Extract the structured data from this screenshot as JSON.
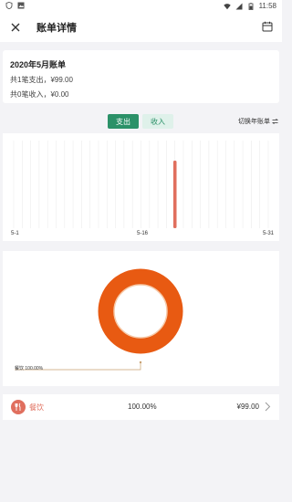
{
  "status_bar": {
    "time": "11:58"
  },
  "header": {
    "title": "账单详情"
  },
  "summary": {
    "heading": "2020年5月账单",
    "expense_line": "共1笔支出，¥99.00",
    "income_line": "共0笔收入，¥0.00"
  },
  "tabs": [
    {
      "label": "支出",
      "active": true
    },
    {
      "label": "收入",
      "active": false
    }
  ],
  "switch_year_label": "切换年账单",
  "chart_data": [
    {
      "type": "bar",
      "x_ticks": [
        "5-1",
        "5-16",
        "5-31"
      ],
      "days": 31,
      "series": [
        {
          "values": [
            0,
            0,
            0,
            0,
            0,
            0,
            0,
            0,
            0,
            0,
            0,
            0,
            0,
            0,
            0,
            0,
            0,
            0,
            0,
            0,
            0,
            0,
            0,
            0,
            0,
            0,
            0,
            0,
            0,
            0,
            0
          ]
        }
      ],
      "highlight_day": 20,
      "highlight_value": 99.0,
      "bar_color": "#e06f5e",
      "grid_lines": true
    },
    {
      "type": "pie",
      "style": "donut",
      "slices": [
        {
          "label": "餐饮",
          "percent": 100.0,
          "color": "#e85a12"
        }
      ],
      "callout_text": "餐饮 100.00%"
    }
  ],
  "category_row": {
    "icon": "fork-knife-icon",
    "name": "餐饮",
    "percent": "100.00%",
    "amount": "¥99.00"
  }
}
